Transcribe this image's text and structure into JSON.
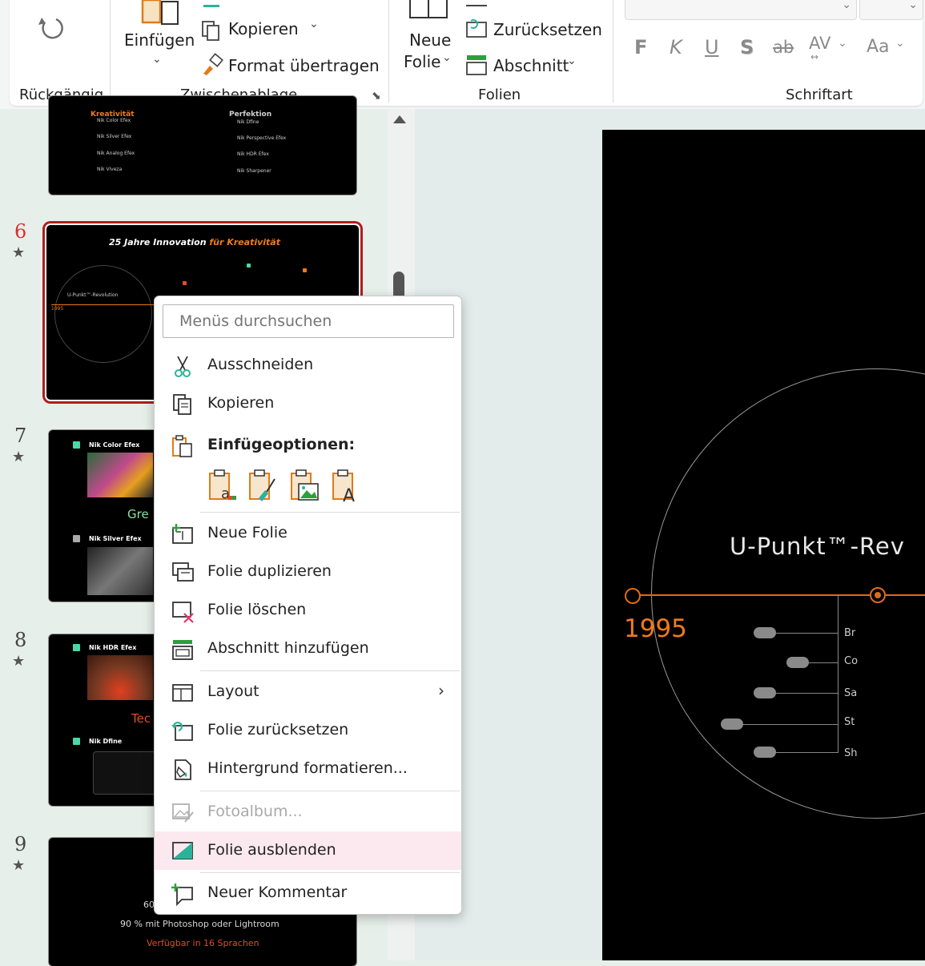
{
  "ribbon": {
    "undo_label": "Rückgängig",
    "paste_label": "Einfügen",
    "copy_label": "Kopieren",
    "format_painter_label": "Format übertragen",
    "clipboard_group": "Zwischenablage",
    "new_slide_line1": "Neue",
    "new_slide_line2": "Folie",
    "reset_label": "Zurücksetzen",
    "section_label": "Abschnitt",
    "slides_group": "Folien",
    "font_group": "Schriftart",
    "fmt_bold": "F",
    "fmt_italic": "K",
    "fmt_underline": "U",
    "fmt_shadow": "S",
    "fmt_strike": "ab",
    "fmt_spacing": "AV",
    "fmt_case": "Aa"
  },
  "thumbnails": {
    "slide6_num": "6",
    "slide7_num": "7",
    "slide8_num": "8",
    "slide9_num": "9",
    "star": "★",
    "s5_left_title": "Kreativität",
    "s5_right_title": "Perfektion",
    "s5_left_items": [
      "Nik Color Efex",
      "Nik Silver Efex",
      "Nik Analog Efex",
      "Nik Viveza"
    ],
    "s5_right_items": [
      "Nik Dfine",
      "Nik Perspective Efex",
      "Nik HDR Efex",
      "Nik Sharpener"
    ],
    "s6_title_white": "25 Jahre Innovation ",
    "s6_title_orange": "für Kreativität",
    "s6_circle_label": "U-Punkt™-Revolution",
    "s6_year": "1995",
    "s7_title1": "Nik Color Efex",
    "s7_caption": "Gre",
    "s7_title2": "Nik Silver Efex",
    "s8_title1": "Nik HDR Efex",
    "s8_caption": "Tec",
    "s8_title2": "Nik Dfine",
    "s9_line1": "60",
    "s9_line2": "90 % mit Photoshop oder Lightroom",
    "s9_line3": "Verfügbar in 16 Sprachen"
  },
  "main_slide": {
    "circle_label": "U-Punkt™-Rev",
    "year": "1995",
    "labels": [
      "Br",
      "Co",
      "Sa",
      "St",
      "Sh"
    ]
  },
  "context_menu": {
    "search_placeholder": "Menüs durchsuchen",
    "cut": "Ausschneiden",
    "copy": "Kopieren",
    "paste_options": "Einfügeoptionen:",
    "new_slide": "Neue Folie",
    "duplicate_slide": "Folie duplizieren",
    "delete_slide": "Folie löschen",
    "add_section": "Abschnitt hinzufügen",
    "layout": "Layout",
    "reset_slide": "Folie zurücksetzen",
    "format_background": "Hintergrund formatieren...",
    "photo_album": "Fotoalbum...",
    "hide_slide": "Folie ausblenden",
    "new_comment": "Neuer Kommentar"
  },
  "colors": {
    "accent_orange": "#f07a1a",
    "selection_red": "#b01d1d",
    "icon_teal": "#2bb39a",
    "icon_green": "#2e9e3e",
    "highlight_pink": "#fbe9ef"
  }
}
